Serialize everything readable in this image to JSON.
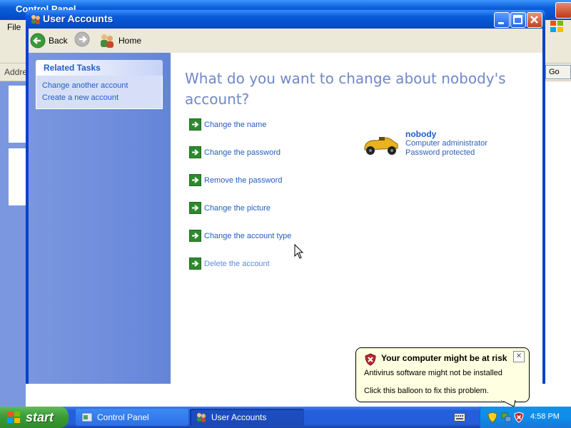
{
  "background_window": {
    "title": "Control Panel",
    "menu_file": "File",
    "address_label": "Address",
    "go_label": "Go"
  },
  "window": {
    "title": "User Accounts"
  },
  "nav": {
    "back": "Back",
    "home": "Home"
  },
  "sidebar": {
    "related_tasks_title": "Related Tasks",
    "tasks": [
      "Change another account",
      "Create a new account"
    ]
  },
  "main": {
    "heading": "What do you want to change about nobody's account?",
    "actions": [
      {
        "label": "Change the name"
      },
      {
        "label": "Change the password"
      },
      {
        "label": "Remove the password"
      },
      {
        "label": "Change the picture"
      },
      {
        "label": "Change the account type"
      },
      {
        "label": "Delete the account"
      }
    ]
  },
  "account": {
    "name": "nobody",
    "type": "Computer administrator",
    "status": "Password protected",
    "picture_icon": "race-car-icon"
  },
  "balloon": {
    "title": "Your computer might be at risk",
    "line1": "Antivirus software might not be installed",
    "line2": "Click this balloon to fix this problem."
  },
  "taskbar": {
    "start": "start",
    "tasks": [
      "Control Panel",
      "User Accounts"
    ],
    "clock": "4:58 PM"
  },
  "colors": {
    "link": "#215dc6",
    "heading": "#6f88c8",
    "sidebar": "#7a96df",
    "titlebar": "#0a5bd8"
  }
}
